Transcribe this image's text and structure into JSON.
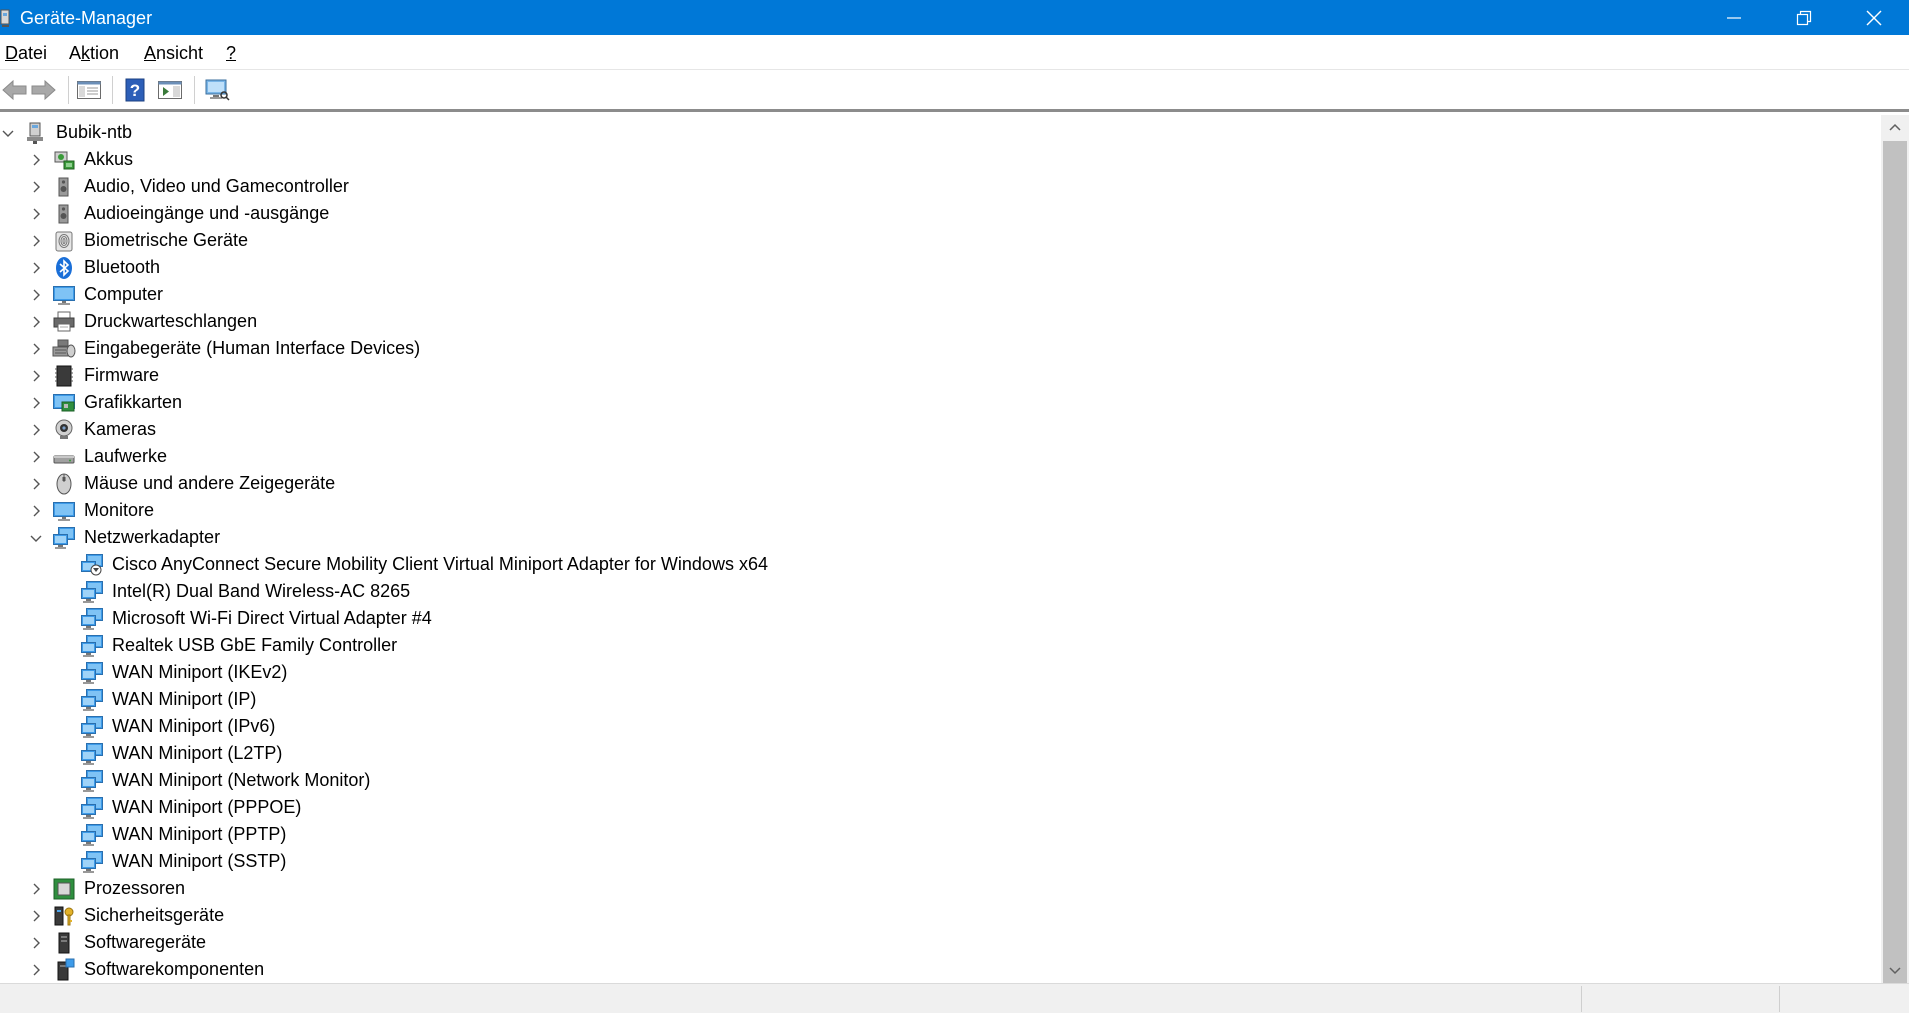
{
  "window": {
    "title": "Geräte-Manager",
    "accent_color": "#0078d7",
    "controls": [
      "minimize-icon",
      "restore-icon",
      "close-icon"
    ]
  },
  "menu": {
    "items": [
      {
        "label": "Datei"
      },
      {
        "label": "Aktion"
      },
      {
        "label": "Ansicht"
      },
      {
        "label": "?"
      }
    ]
  },
  "toolbar": {
    "buttons": [
      {
        "icon": "back-arrow-icon",
        "enabled": false
      },
      {
        "icon": "forward-arrow-icon",
        "enabled": false
      },
      {
        "icon": "console-tree-icon",
        "enabled": true
      },
      {
        "icon": "help-icon",
        "enabled": true
      },
      {
        "icon": "properties-pane-icon",
        "enabled": true
      },
      {
        "icon": "monitor-scan-icon",
        "enabled": true
      }
    ]
  },
  "tree": {
    "root": {
      "label": "Bubik-ntb",
      "icon": "computer-network-icon",
      "expanded": true
    },
    "categories": [
      {
        "label": "Akkus",
        "icon": "battery-icon",
        "expanded": false
      },
      {
        "label": "Audio, Video und Gamecontroller",
        "icon": "speaker-icon",
        "expanded": false
      },
      {
        "label": "Audioeingänge und -ausgänge",
        "icon": "speaker-icon",
        "expanded": false
      },
      {
        "label": "Biometrische Geräte",
        "icon": "fingerprint-icon",
        "expanded": false
      },
      {
        "label": "Bluetooth",
        "icon": "bluetooth-icon",
        "expanded": false
      },
      {
        "label": "Computer",
        "icon": "monitor-icon",
        "expanded": false
      },
      {
        "label": "Druckwarteschlangen",
        "icon": "printer-icon",
        "expanded": false
      },
      {
        "label": "Eingabegeräte (Human Interface Devices)",
        "icon": "keyboard-mouse-icon",
        "expanded": false
      },
      {
        "label": "Firmware",
        "icon": "firmware-chip-icon",
        "expanded": false
      },
      {
        "label": "Grafikkarten",
        "icon": "display-adapter-icon",
        "expanded": false
      },
      {
        "label": "Kameras",
        "icon": "webcam-icon",
        "expanded": false
      },
      {
        "label": "Laufwerke",
        "icon": "disk-drive-icon",
        "expanded": false
      },
      {
        "label": "Mäuse und andere Zeigegeräte",
        "icon": "mouse-icon",
        "expanded": false
      },
      {
        "label": "Monitore",
        "icon": "monitor-icon",
        "expanded": false
      },
      {
        "label": "Netzwerkadapter",
        "icon": "network-adapter-icon",
        "expanded": true,
        "children": [
          {
            "label": "Cisco AnyConnect Secure Mobility Client Virtual Miniport Adapter for Windows x64",
            "icon": "network-adapter-disabled-icon"
          },
          {
            "label": "Intel(R) Dual Band Wireless-AC 8265",
            "icon": "network-adapter-icon"
          },
          {
            "label": "Microsoft Wi-Fi Direct Virtual Adapter #4",
            "icon": "network-adapter-icon"
          },
          {
            "label": "Realtek USB GbE Family Controller",
            "icon": "network-adapter-icon"
          },
          {
            "label": "WAN Miniport (IKEv2)",
            "icon": "network-adapter-icon"
          },
          {
            "label": "WAN Miniport (IP)",
            "icon": "network-adapter-icon"
          },
          {
            "label": "WAN Miniport (IPv6)",
            "icon": "network-adapter-icon"
          },
          {
            "label": "WAN Miniport (L2TP)",
            "icon": "network-adapter-icon"
          },
          {
            "label": "WAN Miniport (Network Monitor)",
            "icon": "network-adapter-icon"
          },
          {
            "label": "WAN Miniport (PPPOE)",
            "icon": "network-adapter-icon"
          },
          {
            "label": "WAN Miniport (PPTP)",
            "icon": "network-adapter-icon"
          },
          {
            "label": "WAN Miniport (SSTP)",
            "icon": "network-adapter-icon"
          }
        ]
      },
      {
        "label": "Prozessoren",
        "icon": "processor-icon",
        "expanded": false
      },
      {
        "label": "Sicherheitsgeräte",
        "icon": "security-key-icon",
        "expanded": false
      },
      {
        "label": "Softwaregeräte",
        "icon": "software-device-icon",
        "expanded": false
      },
      {
        "label": "Softwarekomponenten",
        "icon": "software-component-icon",
        "expanded": false
      }
    ]
  },
  "statusbar": {
    "text": ""
  }
}
